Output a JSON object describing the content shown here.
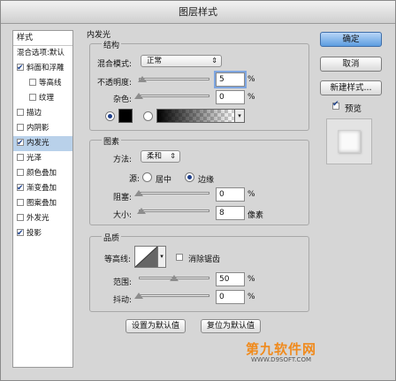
{
  "window": {
    "title": "图层样式"
  },
  "styles_list": {
    "header": "样式",
    "items": [
      {
        "label": "混合选项:默认",
        "checkbox": false,
        "checked": false,
        "indent": false,
        "selected": false
      },
      {
        "label": "斜面和浮雕",
        "checkbox": true,
        "checked": true,
        "indent": false,
        "selected": false
      },
      {
        "label": "等高线",
        "checkbox": true,
        "checked": false,
        "indent": true,
        "selected": false
      },
      {
        "label": "纹理",
        "checkbox": true,
        "checked": false,
        "indent": true,
        "selected": false
      },
      {
        "label": "描边",
        "checkbox": true,
        "checked": false,
        "indent": false,
        "selected": false
      },
      {
        "label": "内阴影",
        "checkbox": true,
        "checked": false,
        "indent": false,
        "selected": false
      },
      {
        "label": "内发光",
        "checkbox": true,
        "checked": true,
        "indent": false,
        "selected": true
      },
      {
        "label": "光泽",
        "checkbox": true,
        "checked": false,
        "indent": false,
        "selected": false
      },
      {
        "label": "颜色叠加",
        "checkbox": true,
        "checked": false,
        "indent": false,
        "selected": false
      },
      {
        "label": "渐变叠加",
        "checkbox": true,
        "checked": true,
        "indent": false,
        "selected": false
      },
      {
        "label": "图案叠加",
        "checkbox": true,
        "checked": false,
        "indent": false,
        "selected": false
      },
      {
        "label": "外发光",
        "checkbox": true,
        "checked": false,
        "indent": false,
        "selected": false
      },
      {
        "label": "投影",
        "checkbox": true,
        "checked": true,
        "indent": false,
        "selected": false
      }
    ]
  },
  "inner_glow": {
    "title": "内发光",
    "structure": {
      "title": "结构",
      "blend_mode_label": "混合模式:",
      "blend_mode_value": "正常",
      "opacity_label": "不透明度:",
      "opacity_value": "5",
      "opacity_unit": "%",
      "opacity_level": 0.05,
      "noise_label": "杂色:",
      "noise_value": "0",
      "noise_unit": "%",
      "noise_level": 0,
      "color_swatch": "#000000"
    },
    "elements": {
      "title": "图素",
      "method_label": "方法:",
      "method_value": "柔和",
      "source_label": "源:",
      "source_center": "居中",
      "source_edge": "边缘",
      "choke_label": "阻塞:",
      "choke_value": "0",
      "choke_unit": "%",
      "choke_level": 0,
      "size_label": "大小:",
      "size_value": "8",
      "size_unit": "像素",
      "size_level": 0.032
    },
    "quality": {
      "title": "品质",
      "contour_label": "等高线:",
      "anti_alias_label": "消除锯齿",
      "range_label": "范围:",
      "range_value": "50",
      "range_unit": "%",
      "range_level": 0.5,
      "jitter_label": "抖动:",
      "jitter_value": "0",
      "jitter_unit": "%",
      "jitter_level": 0
    },
    "set_default": "设置为默认值",
    "reset_default": "复位为默认值"
  },
  "buttons": {
    "ok": "确定",
    "cancel": "取消",
    "new_style": "新建样式...",
    "preview": "预览"
  },
  "watermark": {
    "brand": "第九软件网",
    "site": "WWW.D9SOFT.COM"
  },
  "colors": {
    "selection": "#b9d1ea",
    "ok_button": "#5c9de0"
  }
}
